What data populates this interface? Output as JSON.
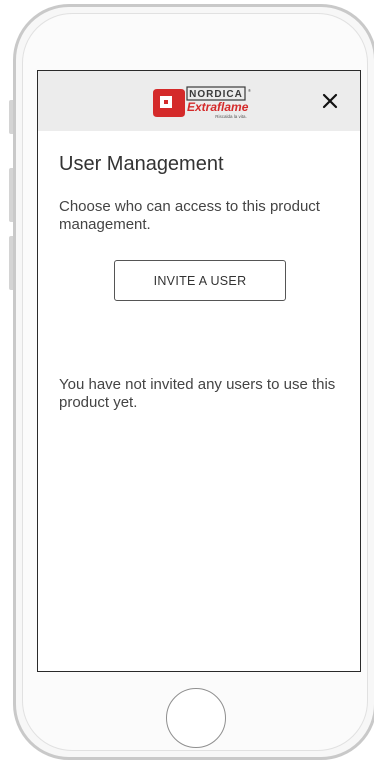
{
  "header": {
    "logo": {
      "brand_top": "NORDICA",
      "brand_main": "Extraflame",
      "tagline": "Riscalda la vita.",
      "colors": {
        "red": "#d42a2a",
        "dark": "#3a3a3a"
      }
    },
    "close_icon": "×"
  },
  "main": {
    "title": "User Management",
    "description": "Choose who can access to this product management.",
    "invite_button": "INVITE A USER",
    "empty_message": "You have not invited any users to use this product yet."
  },
  "icons": {
    "close": "close-icon",
    "home": "home-button"
  },
  "colors": {
    "header_bg": "#ececec",
    "text": "#333333",
    "brand_red": "#d42a2a"
  }
}
